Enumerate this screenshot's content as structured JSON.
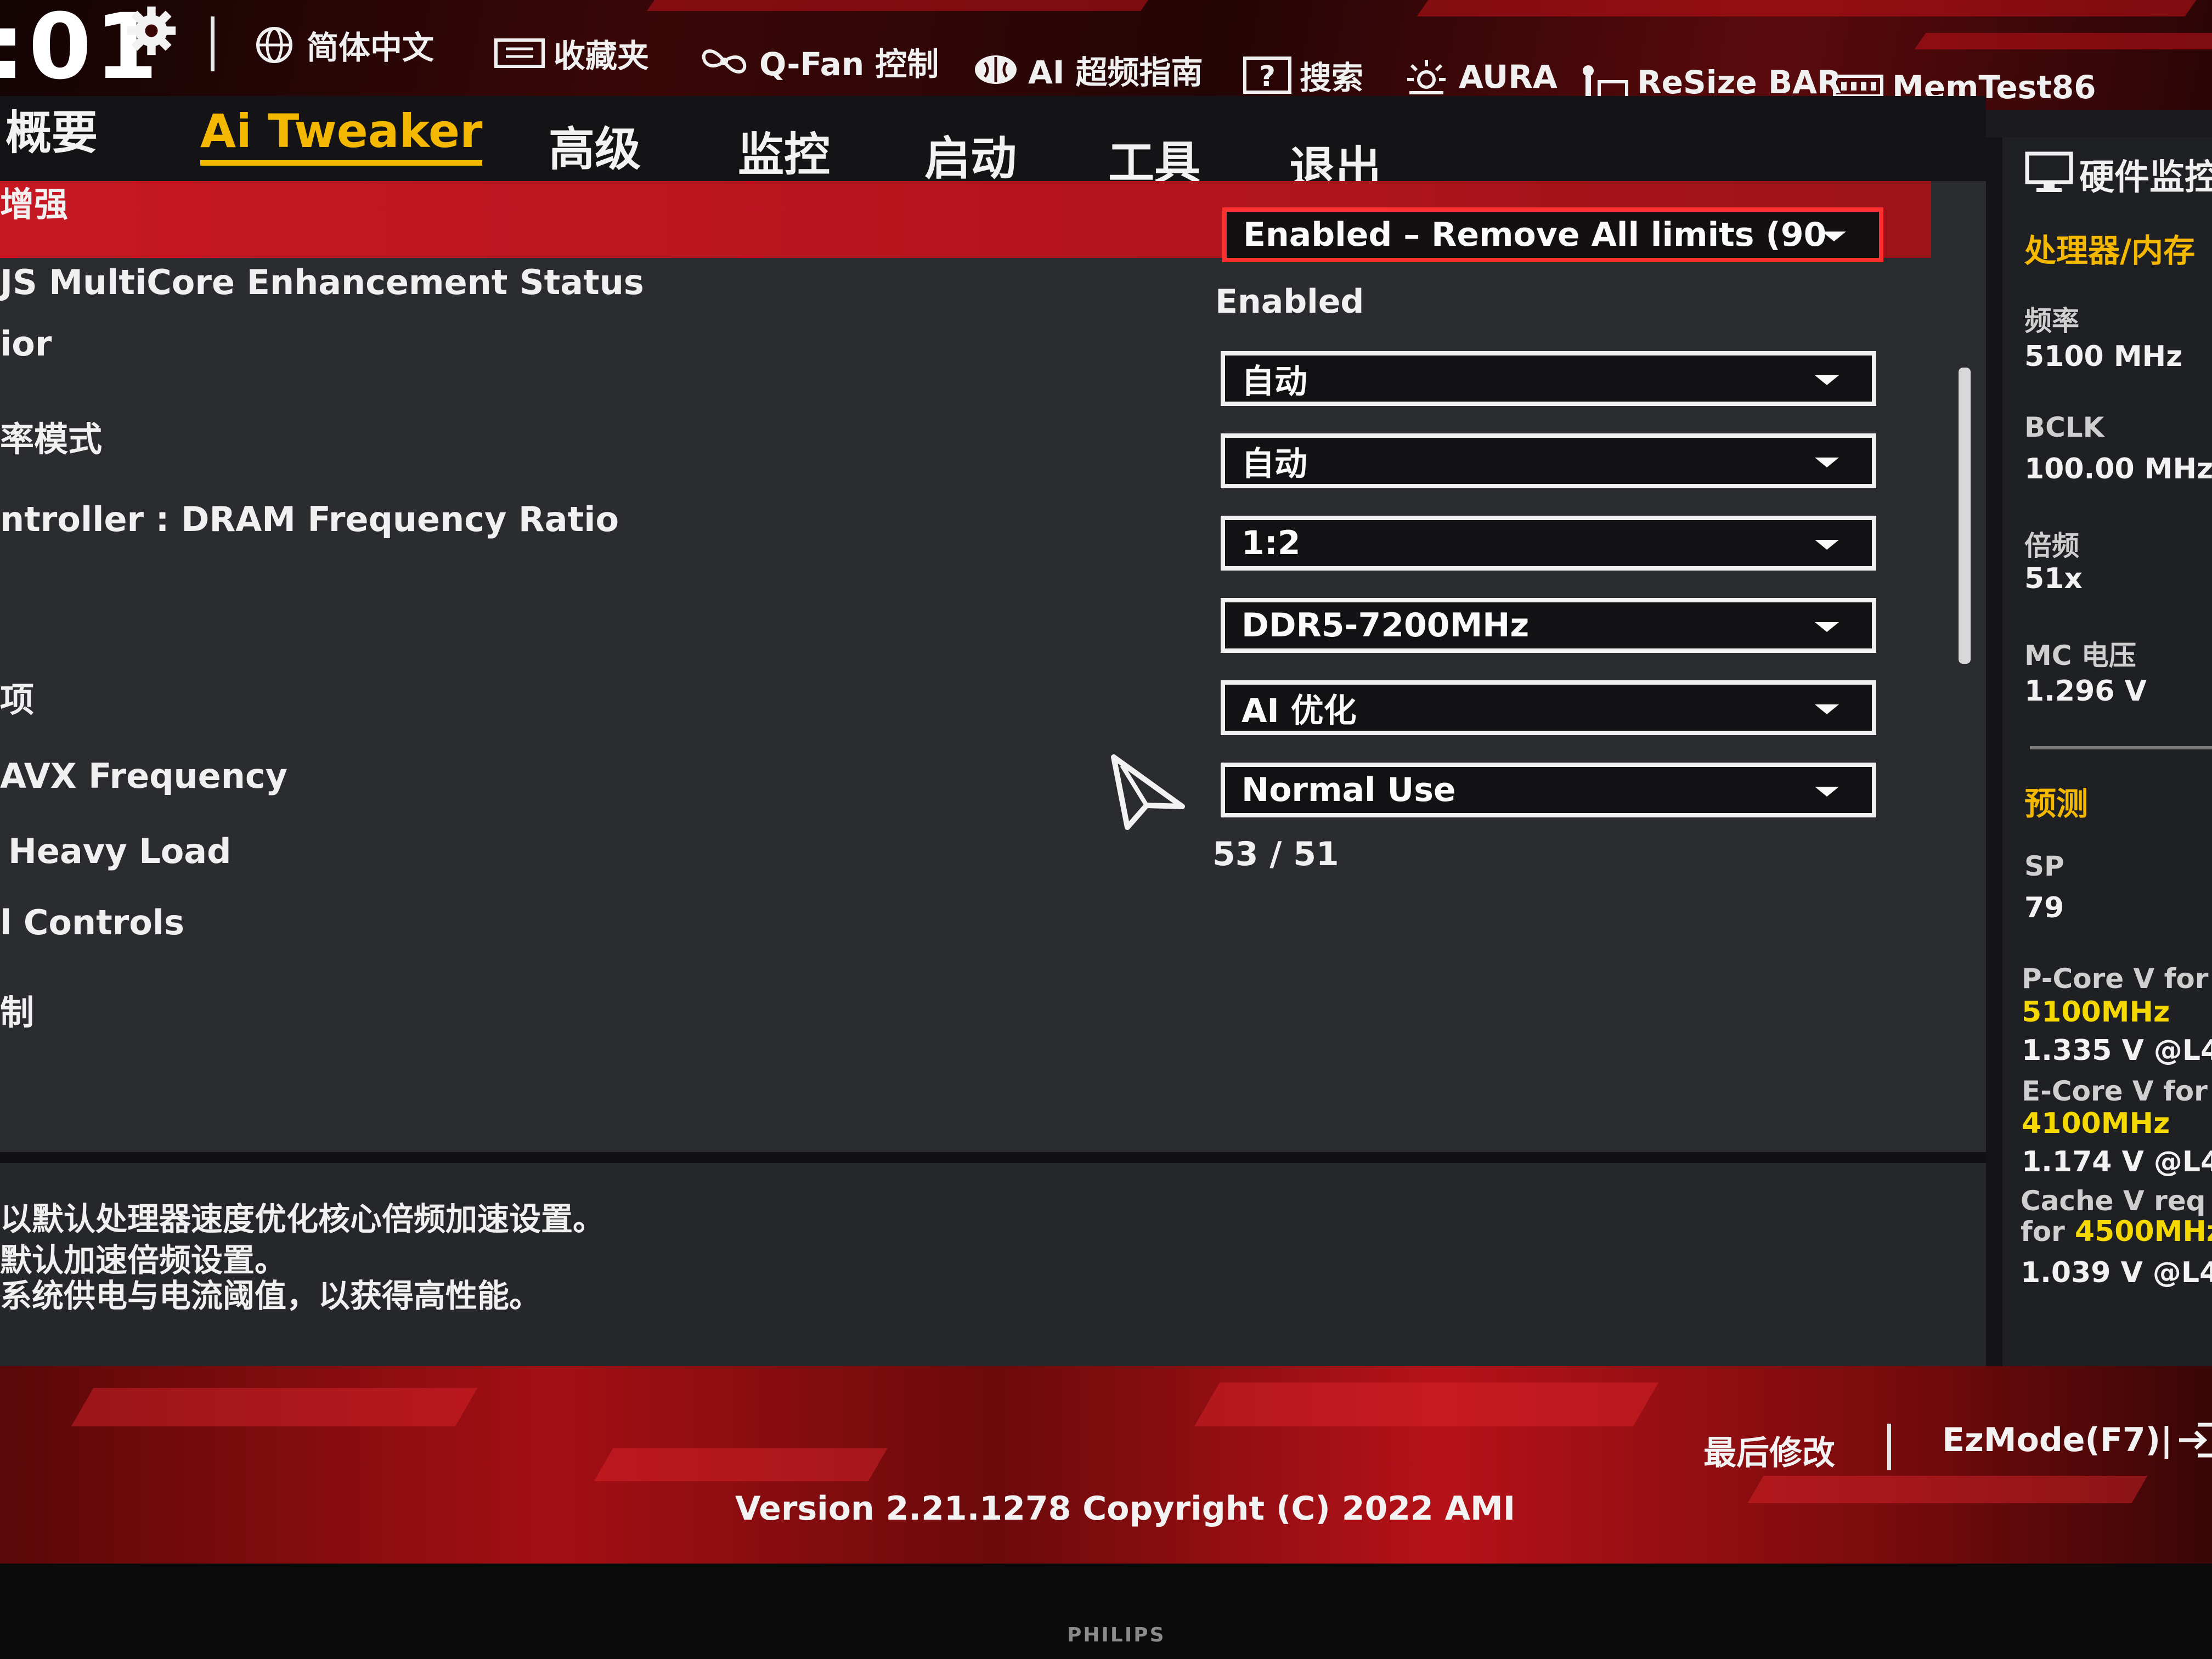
{
  "header": {
    "clock": ":01",
    "tools": [
      {
        "icon": "globe-icon",
        "label": "简体中文"
      },
      {
        "icon": "favorites-icon",
        "label": "收藏夹"
      },
      {
        "icon": "fan-icon",
        "label": "Q-Fan 控制"
      },
      {
        "icon": "ai-brain-icon",
        "label": "AI 超频指南"
      },
      {
        "icon": "help-search-icon",
        "label": "搜索"
      },
      {
        "icon": "aura-light-icon",
        "label": "AURA"
      },
      {
        "icon": "resize-bar-icon",
        "label": "ReSize BAR"
      },
      {
        "icon": "memtest-icon",
        "label": "MemTest86"
      }
    ]
  },
  "tabs": [
    "概要",
    "Ai Tweaker",
    "高级",
    "监控",
    "启动",
    "工具",
    "退出"
  ],
  "active_tab": "Ai Tweaker",
  "settings": [
    {
      "label": "增强",
      "value": "Enabled – Remove All limits (90",
      "kind": "dropdown",
      "selected": true
    },
    {
      "label": "JS MultiCore Enhancement Status",
      "value": "Enabled",
      "kind": "text"
    },
    {
      "label": "ior",
      "value": "自动",
      "kind": "dropdown"
    },
    {
      "label": "率模式",
      "value": "自动",
      "kind": "dropdown"
    },
    {
      "label": "ntroller : DRAM Frequency Ratio",
      "value": "1:2",
      "kind": "dropdown"
    },
    {
      "label": "",
      "value": "DDR5-7200MHz",
      "kind": "dropdown"
    },
    {
      "label": "项",
      "value": "AI 优化",
      "kind": "dropdown"
    },
    {
      "label": "AVX Frequency",
      "value": "Normal Use",
      "kind": "dropdown"
    },
    {
      "label": "Heavy Load",
      "value": "53 / 51",
      "kind": "text"
    },
    {
      "label": "l Controls",
      "value": "",
      "kind": "none"
    },
    {
      "label": "制",
      "value": "",
      "kind": "none"
    }
  ],
  "help_text": [
    "以默认处理器速度优化核心倍频加速设置。",
    "默认加速倍频设置。",
    "系统供电与电流阈值，以获得高性能。"
  ],
  "monitor": {
    "title": "硬件监控",
    "section_cpu": "处理器/内存",
    "items": [
      {
        "label": "频率",
        "value": "5100 MHz"
      },
      {
        "label": "BCLK",
        "value": "100.00 MHz"
      },
      {
        "label": "倍频",
        "value": "51x"
      },
      {
        "label": "MC 电压",
        "value": "1.296 V"
      }
    ],
    "section_predict": "预测",
    "sp_label": "SP",
    "sp_value": "79",
    "pcore_label": "P-Core V for",
    "pcore_freq": "5100MHz",
    "pcore_value": "1.335 V @L4",
    "ecore_label": "E-Core V for",
    "ecore_freq": "4100MHz",
    "ecore_value": "1.174 V @L4",
    "cache_label": "Cache V req",
    "cache_for": "for",
    "cache_freq": "4500MHz",
    "cache_value": "1.039 V @L4"
  },
  "footer": {
    "last_modified": "最后修改",
    "ezmode": "EzMode(F7)|",
    "version": "Version 2.21.1278 Copyright (C) 2022 AMI"
  },
  "monitor_brand": "PHILIPS",
  "colors": {
    "accent": "#f5b800",
    "highlight": "#c71822",
    "panel": "#2b2c2f"
  }
}
